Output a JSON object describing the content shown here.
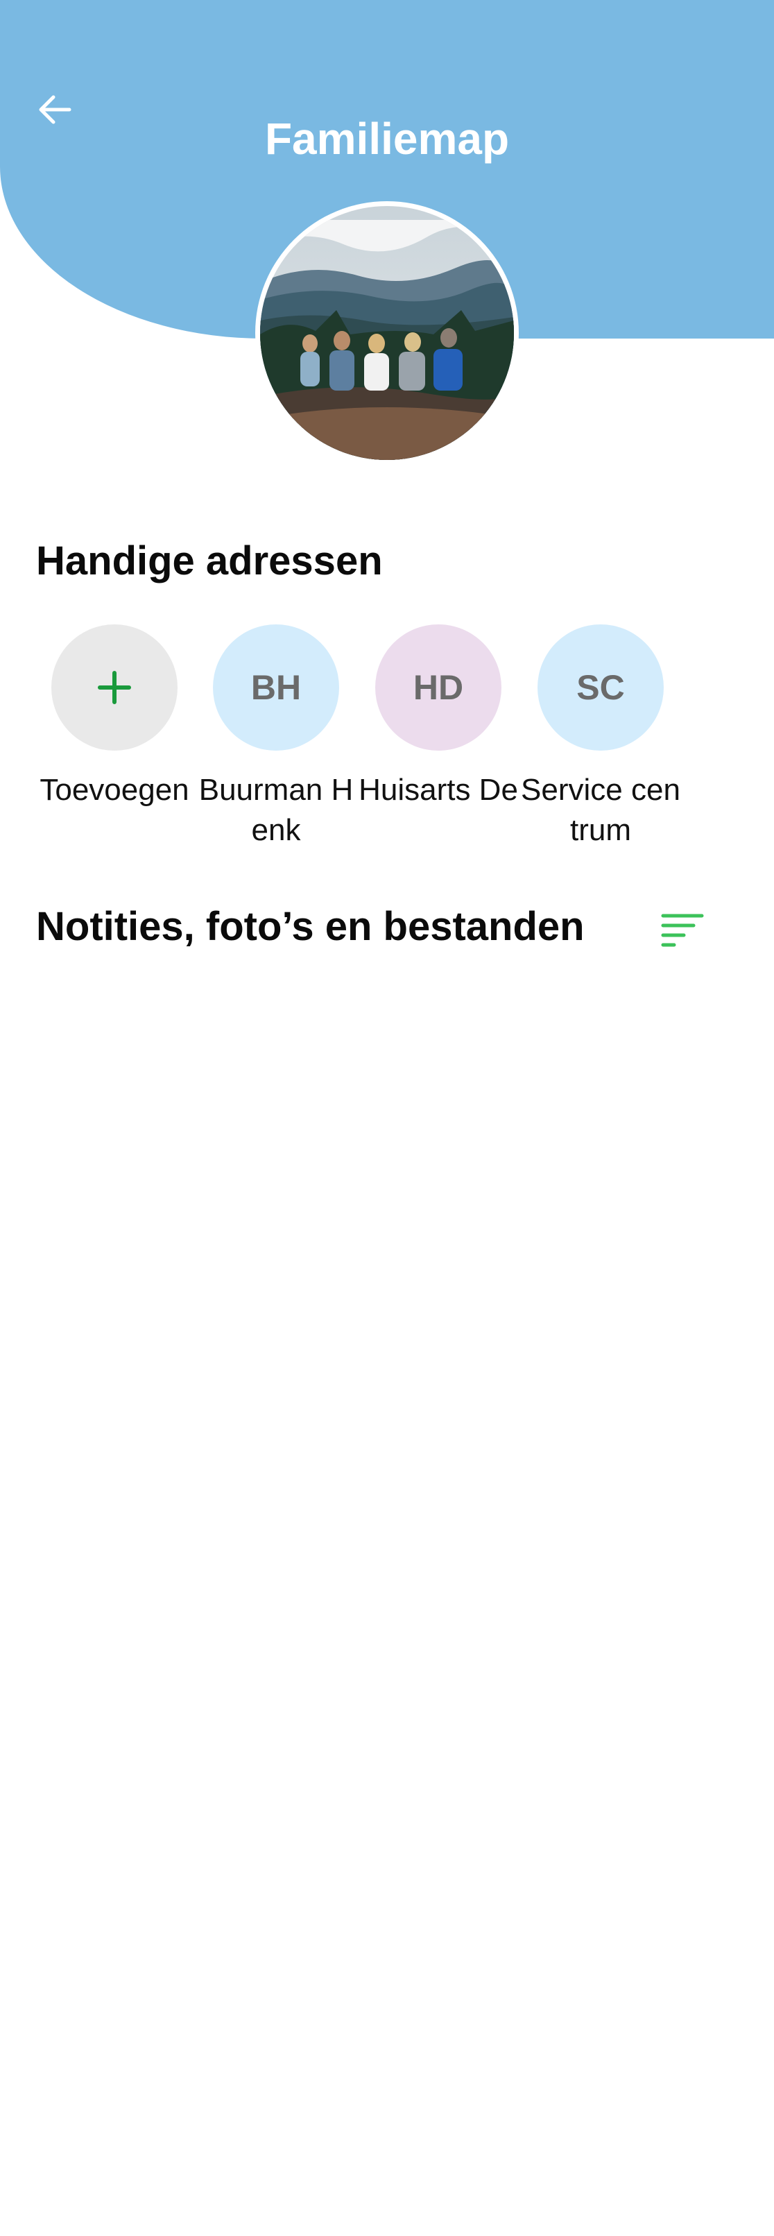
{
  "header": {
    "title": "Familiemap",
    "bg_color": "#7ab9e2",
    "back_icon": "arrow-left-icon"
  },
  "handy_addresses": {
    "title": "Handige adressen",
    "add": {
      "label": "Toevoegen",
      "icon": "plus-icon",
      "color": "#e9e9e9",
      "icon_color": "#1a9a3c"
    },
    "contacts": [
      {
        "initials": "BH",
        "name": "Buurman Henk",
        "color": "#d3ecfc"
      },
      {
        "initials": "HD",
        "name": "Huisarts De",
        "color": "#ecdced"
      },
      {
        "initials": "SC",
        "name": "Service centrum",
        "color": "#d3ecfc"
      }
    ]
  },
  "notes": {
    "title": "Notities, foto’s en bestanden",
    "filter_icon": "sort-filter-icon",
    "accent": "#3cc25a"
  }
}
